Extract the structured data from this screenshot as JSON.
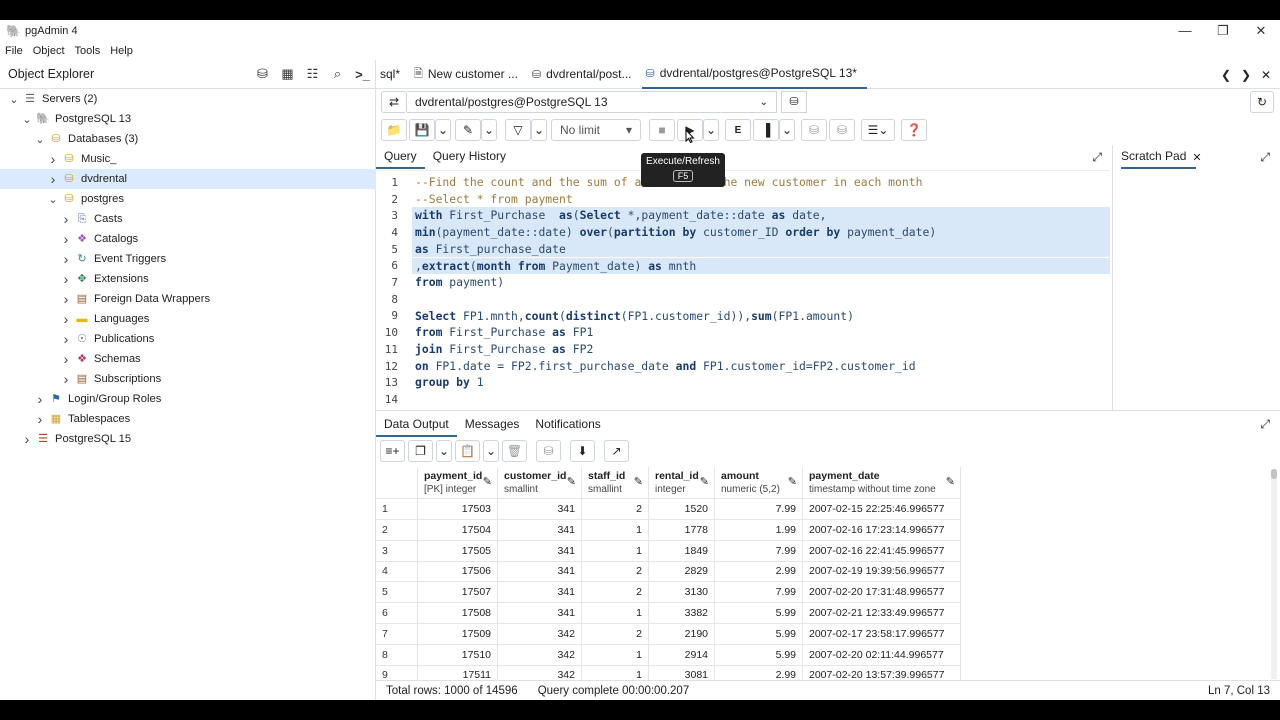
{
  "window": {
    "title": "pgAdmin 4"
  },
  "menu": [
    "File",
    "Object",
    "Tools",
    "Help"
  ],
  "explorer": {
    "title": "Object Explorer",
    "tree": [
      {
        "label": "Servers (2)",
        "depth": 0,
        "icon": "servers-icon",
        "expanded": true
      },
      {
        "label": "PostgreSQL 13",
        "depth": 1,
        "icon": "elephant-icon",
        "expanded": true
      },
      {
        "label": "Databases (3)",
        "depth": 2,
        "icon": "databases-icon",
        "expanded": true
      },
      {
        "label": "Music_",
        "depth": 3,
        "icon": "database-icon",
        "expanded": false
      },
      {
        "label": "dvdrental",
        "depth": 3,
        "icon": "database-icon",
        "expanded": false,
        "selected": true
      },
      {
        "label": "postgres",
        "depth": 3,
        "icon": "database-icon",
        "expanded": true
      },
      {
        "label": "Casts",
        "depth": 4,
        "icon": "casts-icon",
        "expanded": false
      },
      {
        "label": "Catalogs",
        "depth": 4,
        "icon": "catalogs-icon",
        "expanded": false
      },
      {
        "label": "Event Triggers",
        "depth": 4,
        "icon": "event-trigger-icon",
        "expanded": false
      },
      {
        "label": "Extensions",
        "depth": 4,
        "icon": "extensions-icon",
        "expanded": false
      },
      {
        "label": "Foreign Data Wrappers",
        "depth": 4,
        "icon": "fdw-icon",
        "expanded": false
      },
      {
        "label": "Languages",
        "depth": 4,
        "icon": "languages-icon",
        "expanded": false
      },
      {
        "label": "Publications",
        "depth": 4,
        "icon": "publications-icon",
        "expanded": false
      },
      {
        "label": "Schemas",
        "depth": 4,
        "icon": "schemas-icon",
        "expanded": false
      },
      {
        "label": "Subscriptions",
        "depth": 4,
        "icon": "subscriptions-icon",
        "expanded": false
      },
      {
        "label": "Login/Group Roles",
        "depth": 2,
        "icon": "roles-icon",
        "expanded": false
      },
      {
        "label": "Tablespaces",
        "depth": 2,
        "icon": "tablespaces-icon",
        "expanded": false
      },
      {
        "label": "PostgreSQL 15",
        "depth": 1,
        "icon": "server-disconnected-icon",
        "expanded": false
      }
    ]
  },
  "tabs": [
    {
      "icon": "sql-icon",
      "label": "sql*"
    },
    {
      "icon": "document-icon",
      "label": "New customer ..."
    },
    {
      "icon": "database-query-icon",
      "label": "dvdrental/post..."
    },
    {
      "icon": "database-query-icon",
      "label": "dvdrental/postgres@PostgreSQL 13*",
      "active": true
    }
  ],
  "connection": {
    "value": "dvdrental/postgres@PostgreSQL 13"
  },
  "toolbar": {
    "limit": "No limit"
  },
  "tooltip": {
    "text": "Execute/Refresh",
    "key": "F5"
  },
  "query_tabs": {
    "query": "Query",
    "history": "Query History"
  },
  "scratch": {
    "label": "Scratch Pad"
  },
  "editor": {
    "lines": [
      {
        "n": "1",
        "text": "--Find the count and the sum of amount from the new customer in each month",
        "type": "comment"
      },
      {
        "n": "2",
        "text": "--Select * from payment",
        "type": "comment"
      },
      {
        "n": "3",
        "text": "with First_Purchase  as(Select *,payment_date::date as date,",
        "hl": true
      },
      {
        "n": "4",
        "text": "min(payment_date::date) over(partition by customer_ID order by payment_date)",
        "hl": true
      },
      {
        "n": "5",
        "text": "as First_purchase_date",
        "hl": true
      },
      {
        "n": "6",
        "text": ",extract(month from Payment_date) as mnth",
        "hl": true
      },
      {
        "n": "7",
        "text": "from payment)"
      },
      {
        "n": "8",
        "text": ""
      },
      {
        "n": "9",
        "text": "Select FP1.mnth,count(distinct(FP1.customer_id)),sum(FP1.amount)"
      },
      {
        "n": "10",
        "text": "from First_Purchase as FP1"
      },
      {
        "n": "11",
        "text": "join First_Purchase as FP2"
      },
      {
        "n": "12",
        "text": "on FP1.date = FP2.first_purchase_date and FP1.customer_id=FP2.customer_id"
      },
      {
        "n": "13",
        "text": "group by 1"
      },
      {
        "n": "14",
        "text": ""
      }
    ]
  },
  "result_tabs": {
    "data": "Data Output",
    "messages": "Messages",
    "notifications": "Notifications"
  },
  "grid": {
    "columns": [
      {
        "name": "payment_id",
        "type": "[PK] integer"
      },
      {
        "name": "customer_id",
        "type": "smallint"
      },
      {
        "name": "staff_id",
        "type": "smallint"
      },
      {
        "name": "rental_id",
        "type": "integer"
      },
      {
        "name": "amount",
        "type": "numeric (5,2)"
      },
      {
        "name": "payment_date",
        "type": "timestamp without time zone"
      }
    ],
    "rows": [
      [
        "1",
        "17503",
        "341",
        "2",
        "1520",
        "7.99",
        "2007-02-15 22:25:46.996577"
      ],
      [
        "2",
        "17504",
        "341",
        "1",
        "1778",
        "1.99",
        "2007-02-16 17:23:14.996577"
      ],
      [
        "3",
        "17505",
        "341",
        "1",
        "1849",
        "7.99",
        "2007-02-16 22:41:45.996577"
      ],
      [
        "4",
        "17506",
        "341",
        "2",
        "2829",
        "2.99",
        "2007-02-19 19:39:56.996577"
      ],
      [
        "5",
        "17507",
        "341",
        "2",
        "3130",
        "7.99",
        "2007-02-20 17:31:48.996577"
      ],
      [
        "6",
        "17508",
        "341",
        "1",
        "3382",
        "5.99",
        "2007-02-21 12:33:49.996577"
      ],
      [
        "7",
        "17509",
        "342",
        "2",
        "2190",
        "5.99",
        "2007-02-17 23:58:17.996577"
      ],
      [
        "8",
        "17510",
        "342",
        "1",
        "2914",
        "5.99",
        "2007-02-20 02:11:44.996577"
      ],
      [
        "9",
        "17511",
        "342",
        "1",
        "3081",
        "2.99",
        "2007-02-20 13:57:39.996577"
      ]
    ]
  },
  "status": {
    "rows": "Total rows: 1000 of 14596",
    "query": "Query complete 00:00:00.207",
    "position": "Ln 7, Col 13"
  },
  "colors": {
    "accent": "#326690",
    "selection": "#dbeafe",
    "highlight": "#d8e8f9"
  }
}
